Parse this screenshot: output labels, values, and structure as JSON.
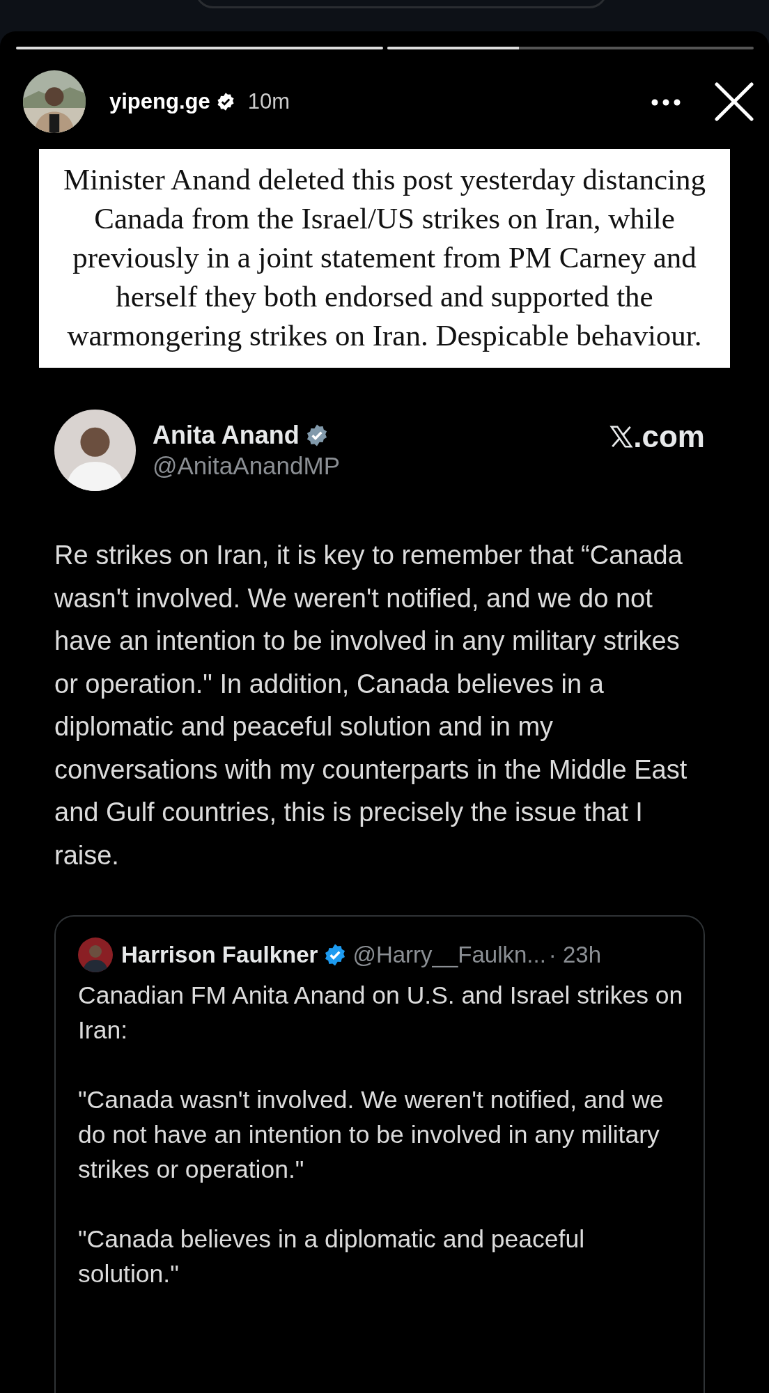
{
  "story": {
    "progress": [
      {
        "level": 1
      },
      {
        "level": 0.36
      }
    ],
    "user": {
      "name": "yipeng.ge",
      "verified": true,
      "time": "10m"
    },
    "caption": "Minister Anand deleted this post yesterday distancing Canada from the Israel/US strikes on Iran, while previously in a joint statement from PM Carney and herself they both endorsed and supported the warmongering strikes on Iran. Despicable behaviour."
  },
  "tweet": {
    "name": "Anita Anand",
    "verified": true,
    "badge": {
      "color": "#829aab"
    },
    "handle": "@AnitaAnandMP",
    "source": ".com",
    "text": "Re strikes on Iran, it is key to remember that “Canada wasn't involved. We weren't notified, and we do not have an intention to be involved in any military strikes or operation.\" In addition, Canada believes in a diplomatic and peaceful solution and in my conversations with my counterparts in the Middle East and Gulf countries, this is precisely the issue that I raise.",
    "quote": {
      "name": "Harrison Faulkner",
      "verified": true,
      "badge": {
        "color": "#1d9bf0"
      },
      "handle": "@Harry__Faulkn...",
      "time": "· 23h",
      "paragraphs": [
        "Canadian FM Anita Anand on U.S. and Israel strikes on Iran:",
        "\"Canada wasn't involved. We weren't notified, and we do not have an intention to be involved in any military strikes or operation.\"",
        "\"Canada believes in a diplomatic and peaceful solution.\""
      ]
    }
  }
}
